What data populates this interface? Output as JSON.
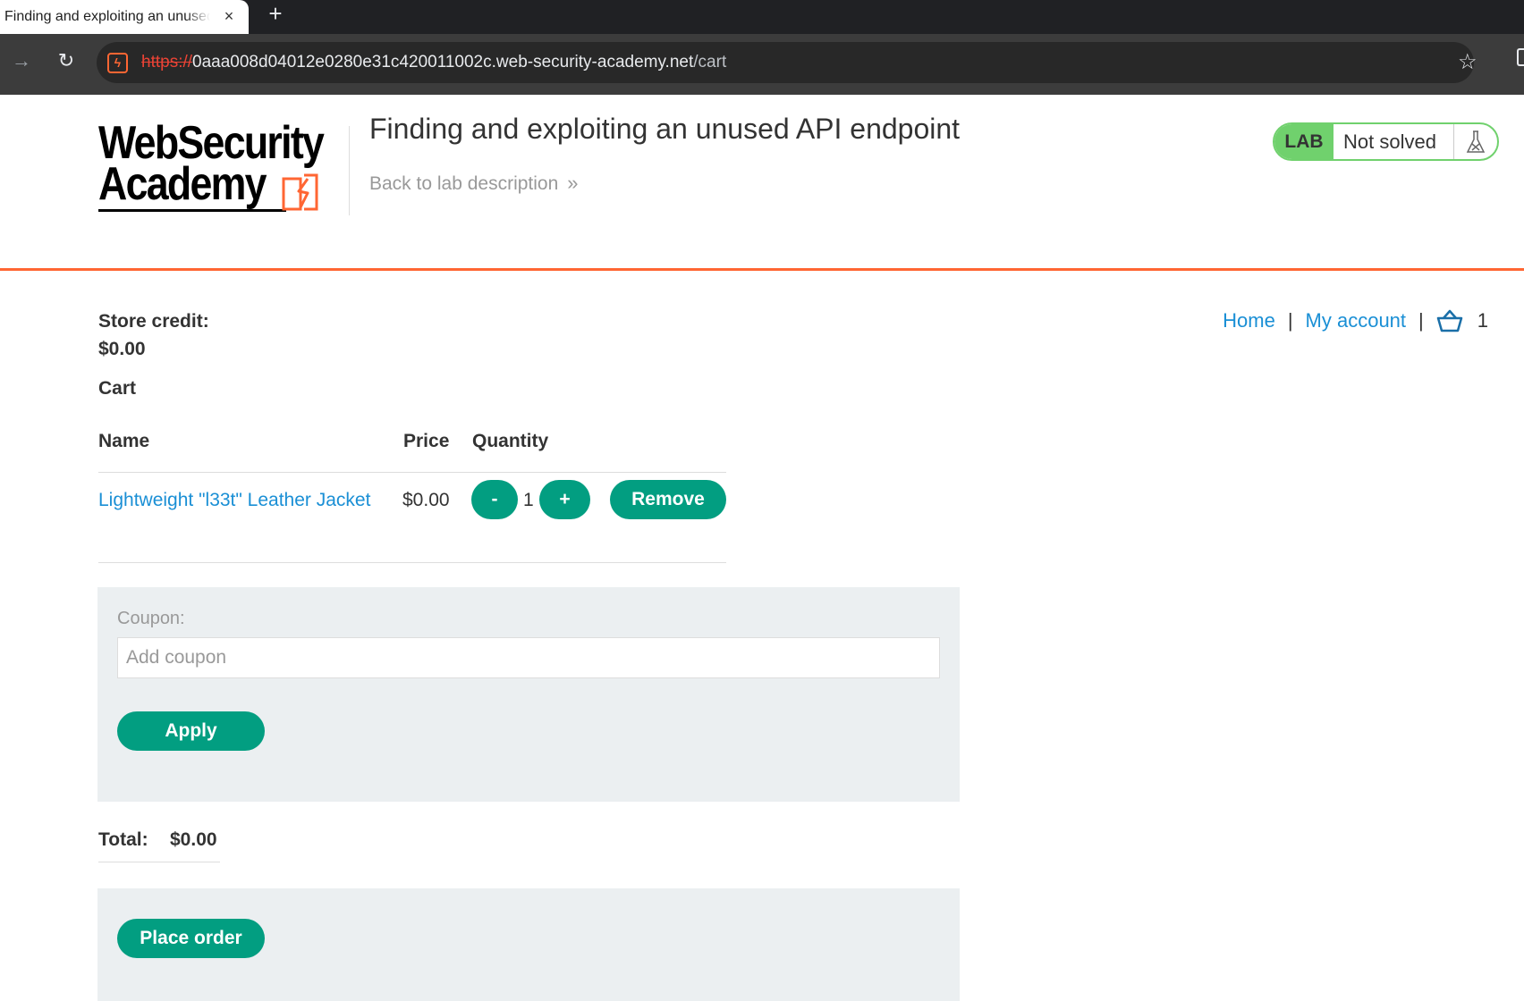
{
  "browser": {
    "tab_title": "Finding and exploiting an unused API endpoint",
    "tab_close_icon": "×",
    "new_tab_icon": "+",
    "url_scheme": "https://",
    "url_host": "0aaa008d04012e0280e31c420011002c.web-security-academy.net",
    "url_path": "/cart",
    "forward_icon": "→",
    "reload_icon": "↻",
    "star_icon": "☆"
  },
  "header": {
    "logo_line1": "WebSecurity",
    "logo_line2": "Academy",
    "lab_title": "Finding and exploiting an unused API endpoint",
    "back_link": "Back to lab description",
    "back_chevron": "»",
    "lab_badge": "LAB",
    "lab_status": "Not solved"
  },
  "nav": {
    "home": "Home",
    "separator": "|",
    "my_account": "My account",
    "cart_count": "1"
  },
  "store": {
    "credit_label": "Store credit:",
    "credit_value": "$0.00",
    "cart_title": "Cart"
  },
  "cart": {
    "columns": [
      "Name",
      "Price",
      "Quantity"
    ],
    "items": [
      {
        "name": "Lightweight \"l33t\" Leather Jacket",
        "price": "$0.00",
        "quantity": "1",
        "minus_label": "-",
        "plus_label": "+",
        "remove_label": "Remove"
      }
    ]
  },
  "coupon": {
    "label": "Coupon:",
    "placeholder": "Add coupon",
    "value": "",
    "apply_label": "Apply"
  },
  "total": {
    "label": "Total:",
    "value": "$0.00"
  },
  "order": {
    "place_order_label": "Place order"
  },
  "colors": {
    "accent_orange": "#ff6633",
    "button_green": "#029e81",
    "lab_green": "#70d16d",
    "link_blue": "#1a8fd5"
  }
}
